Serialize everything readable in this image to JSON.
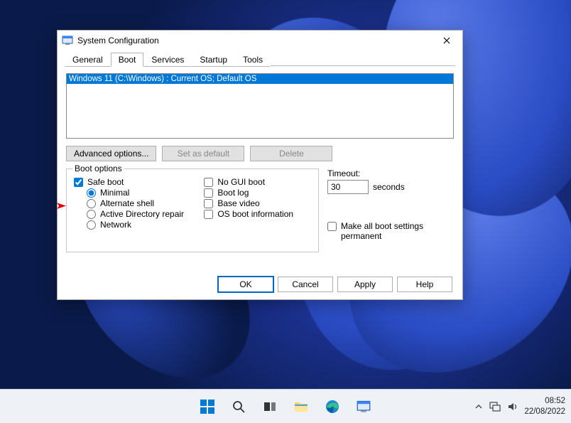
{
  "window": {
    "title": "System Configuration"
  },
  "tabs": [
    "General",
    "Boot",
    "Services",
    "Startup",
    "Tools"
  ],
  "oslist": {
    "selected": "Windows 11 (C:\\Windows) : Current OS; Default OS"
  },
  "buttons": {
    "advanced": "Advanced options...",
    "set_default": "Set as default",
    "delete": "Delete"
  },
  "boot_options": {
    "legend": "Boot options",
    "safe_boot": "Safe boot",
    "minimal": "Minimal",
    "alt_shell": "Alternate shell",
    "ad_repair": "Active Directory repair",
    "network": "Network",
    "no_gui": "No GUI boot",
    "boot_log": "Boot log",
    "base_video": "Base video",
    "os_boot_info": "OS boot information"
  },
  "timeout": {
    "label": "Timeout:",
    "value": "30",
    "unit": "seconds",
    "permanent": "Make all boot settings permanent"
  },
  "dialog_buttons": {
    "ok": "OK",
    "cancel": "Cancel",
    "apply": "Apply",
    "help": "Help"
  },
  "taskbar": {
    "time": "08:52",
    "date": "22/08/2022"
  }
}
